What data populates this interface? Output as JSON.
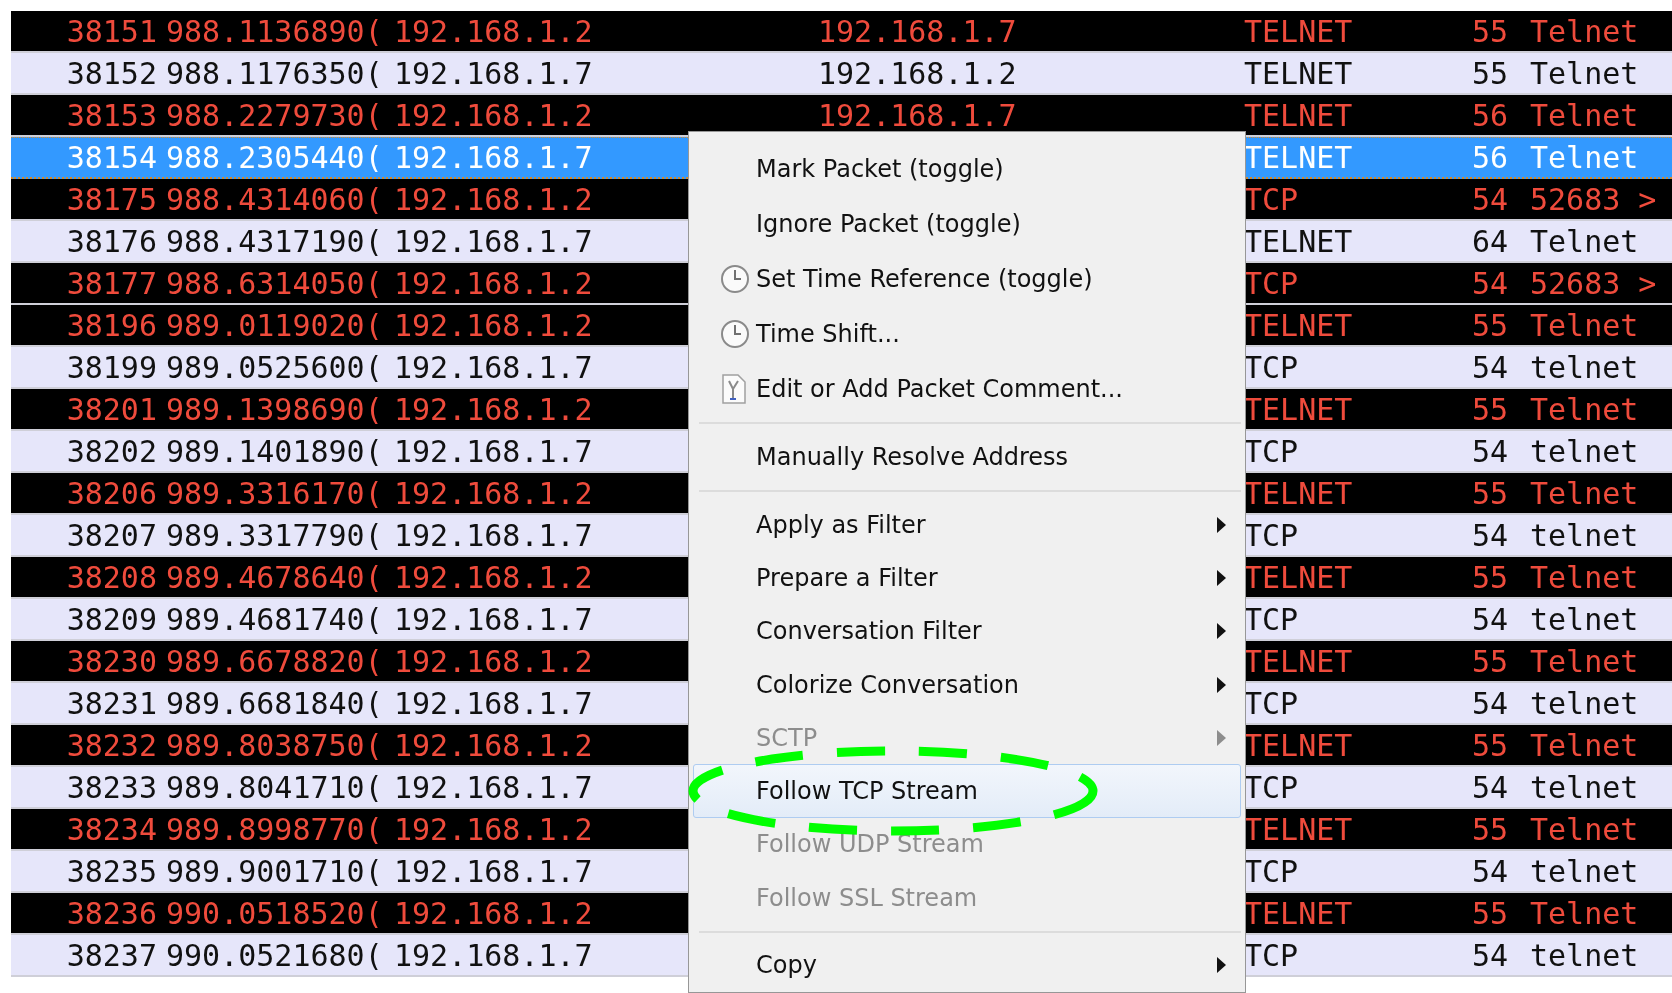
{
  "packet_list": {
    "rows": [
      {
        "no": "38151",
        "time": "988.1136890(",
        "source": "192.168.1.2",
        "destination": "192.168.1.7",
        "protocol": "TELNET",
        "length": "55",
        "info": "Telnet",
        "color": "#000000",
        "selected": false
      },
      {
        "no": "38152",
        "time": "988.1176350(",
        "source": "192.168.1.7",
        "destination": "192.168.1.2",
        "protocol": "TELNET",
        "length": "55",
        "info": "Telnet",
        "color": "#e6e6fa",
        "selected": false
      },
      {
        "no": "38153",
        "time": "988.2279730(",
        "source": "192.168.1.2",
        "destination": "192.168.1.7",
        "protocol": "TELNET",
        "length": "56",
        "info": "Telnet",
        "color": "#000000",
        "selected": false
      },
      {
        "no": "38154",
        "time": "988.2305440(",
        "source": "192.168.1.7",
        "protocol": "TELNET",
        "length": "56",
        "info": "Telnet",
        "color": "#e6e6fa",
        "selected": true
      },
      {
        "no": "38175",
        "time": "988.4314060(",
        "source": "192.168.1.2",
        "protocol": "TCP",
        "length": "54",
        "info": "52683 >",
        "color": "#000000",
        "selected": false
      },
      {
        "no": "38176",
        "time": "988.4317190(",
        "source": "192.168.1.7",
        "protocol": "TELNET",
        "length": "64",
        "info": "Telnet",
        "color": "#e6e6fa",
        "selected": false
      },
      {
        "no": "38177",
        "time": "988.6314050(",
        "source": "192.168.1.2",
        "protocol": "TCP",
        "length": "54",
        "info": "52683 >",
        "color": "#000000",
        "selected": false
      },
      {
        "no": "38196",
        "time": "989.0119020(",
        "source": "192.168.1.2",
        "protocol": "TELNET",
        "length": "55",
        "info": "Telnet",
        "color": "#000000",
        "selected": false
      },
      {
        "no": "38199",
        "time": "989.0525600(",
        "source": "192.168.1.7",
        "protocol": "TCP",
        "length": "54",
        "info": "telnet",
        "color": "#e6e6fa",
        "selected": false
      },
      {
        "no": "38201",
        "time": "989.1398690(",
        "source": "192.168.1.2",
        "protocol": "TELNET",
        "length": "55",
        "info": "Telnet",
        "color": "#000000",
        "selected": false
      },
      {
        "no": "38202",
        "time": "989.1401890(",
        "source": "192.168.1.7",
        "protocol": "TCP",
        "length": "54",
        "info": "telnet",
        "color": "#e6e6fa",
        "selected": false
      },
      {
        "no": "38206",
        "time": "989.3316170(",
        "source": "192.168.1.2",
        "protocol": "TELNET",
        "length": "55",
        "info": "Telnet",
        "color": "#000000",
        "selected": false
      },
      {
        "no": "38207",
        "time": "989.3317790(",
        "source": "192.168.1.7",
        "protocol": "TCP",
        "length": "54",
        "info": "telnet",
        "color": "#e6e6fa",
        "selected": false
      },
      {
        "no": "38208",
        "time": "989.4678640(",
        "source": "192.168.1.2",
        "protocol": "TELNET",
        "length": "55",
        "info": "Telnet",
        "color": "#000000",
        "selected": false
      },
      {
        "no": "38209",
        "time": "989.4681740(",
        "source": "192.168.1.7",
        "protocol": "TCP",
        "length": "54",
        "info": "telnet",
        "color": "#e6e6fa",
        "selected": false
      },
      {
        "no": "38230",
        "time": "989.6678820(",
        "source": "192.168.1.2",
        "protocol": "TELNET",
        "length": "55",
        "info": "Telnet",
        "color": "#000000",
        "selected": false
      },
      {
        "no": "38231",
        "time": "989.6681840(",
        "source": "192.168.1.7",
        "protocol": "TCP",
        "length": "54",
        "info": "telnet",
        "color": "#e6e6fa",
        "selected": false
      },
      {
        "no": "38232",
        "time": "989.8038750(",
        "source": "192.168.1.2",
        "protocol": "TELNET",
        "length": "55",
        "info": "Telnet",
        "color": "#000000",
        "selected": false
      },
      {
        "no": "38233",
        "time": "989.8041710(",
        "source": "192.168.1.7",
        "protocol": "TCP",
        "length": "54",
        "info": "telnet",
        "color": "#e6e6fa",
        "selected": false
      },
      {
        "no": "38234",
        "time": "989.8998770(",
        "source": "192.168.1.2",
        "protocol": "TELNET",
        "length": "55",
        "info": "Telnet",
        "color": "#000000",
        "selected": false
      },
      {
        "no": "38235",
        "time": "989.9001710(",
        "source": "192.168.1.7",
        "protocol": "TCP",
        "length": "54",
        "info": "telnet",
        "color": "#e6e6fa",
        "selected": false
      },
      {
        "no": "38236",
        "time": "990.0518520(",
        "source": "192.168.1.2",
        "protocol": "TELNET",
        "length": "55",
        "info": "Telnet",
        "color": "#000000",
        "selected": false
      },
      {
        "no": "38237",
        "time": "990.0521680(",
        "source": "192.168.1.7",
        "protocol": "TCP",
        "length": "54",
        "info": "telnet",
        "color": "#e6e6fa",
        "selected": false
      }
    ]
  },
  "context_menu": {
    "items": [
      {
        "kind": "item",
        "label": "Mark Packet (toggle)",
        "disabled": false,
        "submenu": false,
        "selected": false
      },
      {
        "kind": "item",
        "label": "Ignore Packet (toggle)",
        "disabled": false,
        "submenu": false,
        "selected": false
      },
      {
        "kind": "clock",
        "label": "Set Time Reference (toggle)",
        "disabled": false,
        "submenu": false,
        "selected": false
      },
      {
        "kind": "clock",
        "label": "Time Shift...",
        "disabled": false,
        "submenu": false,
        "selected": false
      },
      {
        "kind": "comment",
        "label": "Edit or Add Packet Comment...",
        "disabled": false,
        "submenu": false,
        "selected": false
      },
      {
        "kind": "separator"
      },
      {
        "kind": "item",
        "label": "Manually Resolve Address",
        "disabled": false,
        "submenu": false,
        "selected": false
      },
      {
        "kind": "separator"
      },
      {
        "kind": "item",
        "label": "Apply as Filter",
        "disabled": false,
        "submenu": true,
        "selected": false
      },
      {
        "kind": "item",
        "label": "Prepare a Filter",
        "disabled": false,
        "submenu": true,
        "selected": false
      },
      {
        "kind": "item",
        "label": "Conversation Filter",
        "disabled": false,
        "submenu": true,
        "selected": false
      },
      {
        "kind": "item",
        "label": "Colorize Conversation",
        "disabled": false,
        "submenu": true,
        "selected": false
      },
      {
        "kind": "item",
        "label": "SCTP",
        "disabled": true,
        "submenu": true,
        "selected": false
      },
      {
        "kind": "item",
        "label": "Follow TCP Stream",
        "disabled": false,
        "submenu": false,
        "selected": true,
        "circled": true
      },
      {
        "kind": "item",
        "label": "Follow UDP Stream",
        "disabled": true,
        "submenu": false,
        "selected": false
      },
      {
        "kind": "item",
        "label": "Follow SSL Stream",
        "disabled": true,
        "submenu": false,
        "selected": false
      },
      {
        "kind": "separator"
      },
      {
        "kind": "item",
        "label": "Copy",
        "disabled": false,
        "submenu": true,
        "selected": false
      }
    ]
  }
}
